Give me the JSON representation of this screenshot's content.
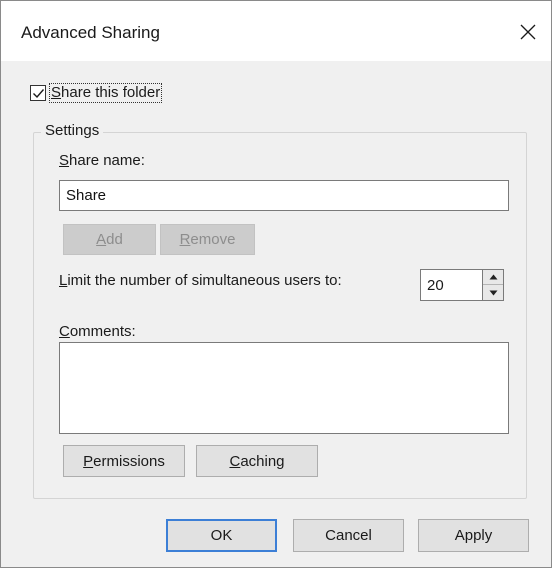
{
  "window": {
    "title": "Advanced Sharing"
  },
  "share_checkbox": {
    "label_prefix": "",
    "label_u": "S",
    "label_rest": "hare this folder",
    "checked": true
  },
  "settings": {
    "legend": "Settings",
    "share_name_label_u": "S",
    "share_name_label_rest": "hare name:",
    "share_name_value": "Share",
    "add_u": "A",
    "add_rest": "dd",
    "remove_u": "R",
    "remove_rest": "emove",
    "limit_label_u": "L",
    "limit_label_rest": "imit the number of simultaneous users to:",
    "limit_value": "20",
    "comments_label_u": "C",
    "comments_label_rest": "omments:",
    "comments_value": "",
    "permissions_u": "P",
    "permissions_rest": "ermissions",
    "caching_u": "C",
    "caching_rest": "aching"
  },
  "footer": {
    "ok": "OK",
    "cancel": "Cancel",
    "apply": "Apply"
  },
  "icons": {
    "close": "close-icon",
    "checkmark": "checkmark-icon",
    "spin_up": "spin-up-icon",
    "spin_down": "spin-down-icon"
  },
  "colors": {
    "dialog_bg": "#f0f0f0",
    "button_bg": "#e1e1e1",
    "disabled_text": "#8d8d8d",
    "default_button_border": "#3c7fd6"
  }
}
